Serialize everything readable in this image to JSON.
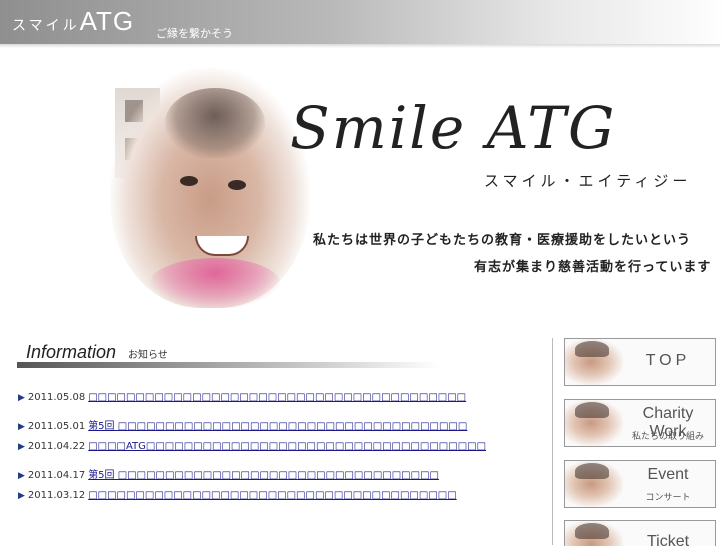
{
  "header": {
    "brand_kana": "スマイル",
    "brand_latin": "ATG",
    "tagline": "ご縁を繋かそう"
  },
  "hero": {
    "logo": "Smile ATG",
    "logo_kana": "スマイル・エイティジー",
    "desc_line1": "私たちは世界の子どもたちの教育・医療援助をしたいという",
    "desc_line2": "有志が集まり慈善活動を行っています"
  },
  "info": {
    "title": "Information",
    "subtitle": "お知らせ",
    "items": [
      {
        "date": "2011.05.08",
        "text": "□□□□□□□□□□□□□□□□□□□□□□□□□□□□□□□□□□□□□□□□"
      },
      {
        "date": "2011.05.01",
        "text": "第5回 □□□□□□□□□□□□□□□□□□□□□□□□□□□□□□□□□□□□□"
      },
      {
        "date": "2011.04.22",
        "text": "□□□□ATG□□□□□□□□□□□□□□□□□□□□□□□□□□□□□□□□□□□□"
      },
      {
        "date": "2011.04.17",
        "text": "第5回 □□□□□□□□□□□□□□□□□□□□□□□□□□□□□□□□□□"
      },
      {
        "date": "2011.03.12",
        "text": "□□□□□□□□□□□□□□□□□□□□□□□□□□□□□□□□□□□□□□□"
      }
    ]
  },
  "nav": [
    {
      "main": "TOP",
      "sub": ""
    },
    {
      "main": "Charity Work",
      "sub": "私たちの取り組み"
    },
    {
      "main": "Event",
      "sub": "コンサート"
    },
    {
      "main": "Ticket",
      "sub": ""
    }
  ],
  "colors": {
    "link": "#1a1a8c",
    "arrow": "#1f3a8a",
    "header_gradient_start": "#8f8f8f"
  }
}
